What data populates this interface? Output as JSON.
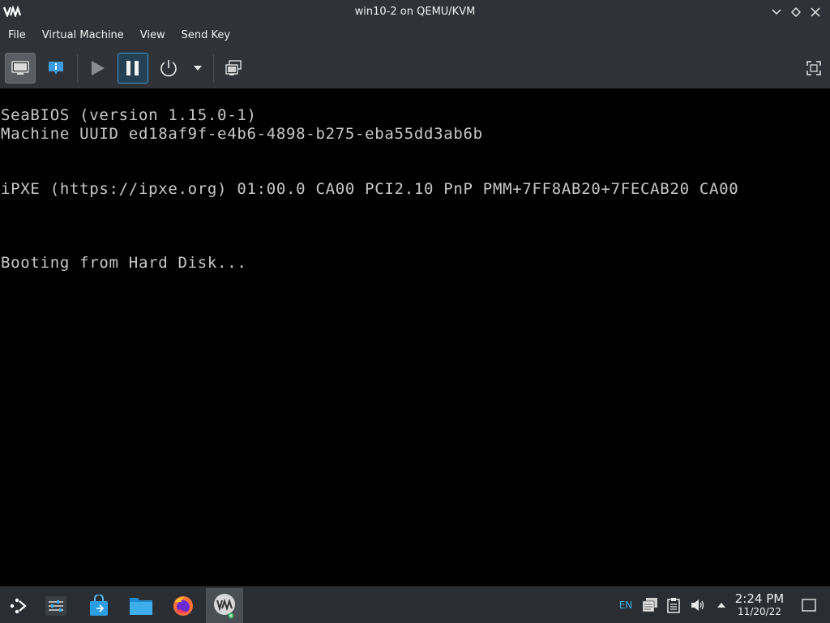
{
  "window": {
    "title": "win10-2 on QEMU/KVM"
  },
  "menu": {
    "items": [
      "File",
      "Virtual Machine",
      "View",
      "Send Key"
    ]
  },
  "toolbar": {
    "buttons": [
      {
        "name": "console",
        "icon": "monitor-icon",
        "state": "pressed"
      },
      {
        "name": "details",
        "icon": "info-icon"
      },
      {
        "name": "run",
        "icon": "play-icon",
        "state": "disabled"
      },
      {
        "name": "pause",
        "icon": "pause-icon",
        "state": "active"
      },
      {
        "name": "shutdown",
        "icon": "power-icon"
      },
      {
        "name": "shutdown-menu",
        "icon": "caret-down-icon"
      },
      {
        "name": "snapshots",
        "icon": "snapshot-icon"
      },
      {
        "name": "fullscreen",
        "icon": "fullscreen-icon"
      }
    ]
  },
  "console": {
    "lines": [
      "SeaBIOS (version 1.15.0-1)",
      "Machine UUID ed18af9f-e4b6-4898-b275-eba55dd3ab6b",
      "iPXE (https://ipxe.org) 01:00.0 CA00 PCI2.10 PnP PMM+7FF8AB20+7FECAB20 CA00",
      "Booting from Hard Disk..."
    ]
  },
  "taskbar": {
    "apps": [
      {
        "name": "application-launcher",
        "icon": "launcher-icon"
      },
      {
        "name": "system-settings",
        "icon": "settings-sliders-icon"
      },
      {
        "name": "discover",
        "icon": "store-bag-icon"
      },
      {
        "name": "dolphin",
        "icon": "folder-icon"
      },
      {
        "name": "firefox",
        "icon": "firefox-icon"
      },
      {
        "name": "virt-manager",
        "icon": "vm-icon"
      }
    ],
    "tray": {
      "keyboard_layout": "EN",
      "time": "2:24 PM",
      "date": "11/20/22"
    }
  },
  "colors": {
    "chrome_bg": "#2f3337",
    "taskbar_bg": "#2a2e32",
    "accent_blue": "#3f95cf",
    "console_text": "#c8c8c8"
  }
}
